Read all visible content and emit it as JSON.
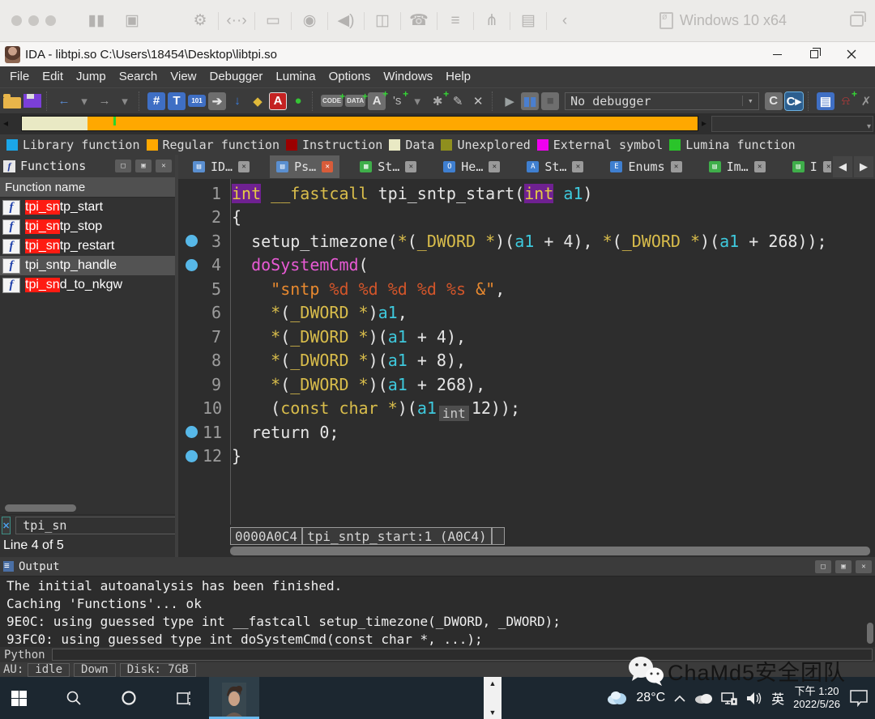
{
  "vm_toolbar": {
    "title": "Windows 10 x64",
    "icons": [
      {
        "name": "pause-icon",
        "glyph": "▮▮"
      },
      {
        "name": "snapshot-icon",
        "glyph": "▣"
      },
      {
        "name": "settings-wrench-icon",
        "glyph": "⚙",
        "gap": 40
      },
      {
        "name": "send-keys-icon",
        "glyph": "‹··›",
        "sep": true
      },
      {
        "name": "hard-disk-icon",
        "glyph": "▭",
        "sep": true
      },
      {
        "name": "webcam-icon",
        "glyph": "◉",
        "sep": true
      },
      {
        "name": "sound-icon",
        "glyph": "◀)",
        "sep": true
      },
      {
        "name": "video-camera-icon",
        "glyph": "◫",
        "sep": true
      },
      {
        "name": "phone-icon",
        "glyph": "☎",
        "sep": true
      },
      {
        "name": "server-icon",
        "glyph": "≡",
        "sep": true
      },
      {
        "name": "usb-icon",
        "glyph": "⋔",
        "sep": true
      },
      {
        "name": "clipboard-icon",
        "glyph": "▤",
        "sep": true
      },
      {
        "name": "back-chevron-icon",
        "glyph": "‹",
        "sep": true
      }
    ]
  },
  "title_bar": {
    "title": "IDA - libtpi.so C:\\Users\\18454\\Desktop\\libtpi.so"
  },
  "menu_bar": {
    "items": [
      "File",
      "Edit",
      "Jump",
      "Search",
      "View",
      "Debugger",
      "Lumina",
      "Options",
      "Windows",
      "Help"
    ]
  },
  "toolbar": {
    "debugger_combo": "No debugger",
    "icons_left": [
      {
        "name": "open-file-icon",
        "cls": "ic-folder"
      },
      {
        "name": "save-icon",
        "cls": "ic-floppy"
      },
      {
        "name": "separator",
        "sep": true
      },
      {
        "name": "back-icon",
        "glyph": "←",
        "color": "#5b8dd6",
        "bold": true
      },
      {
        "name": "back-dropdown-icon",
        "glyph": "▾",
        "color": "#8a8a8a"
      },
      {
        "name": "forward-icon",
        "glyph": "→",
        "color": "#9a9a9a",
        "bold": true
      },
      {
        "name": "forward-dropdown-icon",
        "glyph": "▾",
        "color": "#8a8a8a"
      },
      {
        "name": "separator",
        "sep": true
      },
      {
        "name": "search-address-icon",
        "chip": "chip-blue",
        "glyph": "#"
      },
      {
        "name": "search-text-icon",
        "chip": "chip-blue",
        "glyph": "T"
      },
      {
        "name": "search-binary-icon",
        "chip": "chip-blue chip-sm",
        "glyph": "101"
      },
      {
        "name": "search-next-icon",
        "chip": "chip-gray",
        "glyph": "➔"
      },
      {
        "name": "jump-icon",
        "glyph": "↓",
        "color": "#3a7fe0",
        "bold": true
      },
      {
        "name": "lumina-flashlight-icon",
        "glyph": "◆",
        "color": "#e0b93a"
      },
      {
        "name": "problems-icon",
        "chip": "chip-red",
        "glyph": "A"
      },
      {
        "name": "navband-ok-icon",
        "glyph": "●",
        "color": "#35c435"
      },
      {
        "name": "separator",
        "sep": true
      },
      {
        "name": "make-code-icon",
        "chip": "chip-gray chip-sm",
        "glyph": "CODE",
        "plus": true
      },
      {
        "name": "make-data-icon",
        "chip": "chip-gray chip-sm",
        "glyph": "DATA",
        "plus": true
      },
      {
        "name": "make-name-icon",
        "chip": "chip-gray",
        "glyph": "A",
        "plus": true
      },
      {
        "name": "make-string-icon",
        "glyph": "'s",
        "color": "#b8b8b8",
        "plus": true
      },
      {
        "name": "string-dropdown-icon",
        "glyph": "▾",
        "color": "#8a8a8a"
      },
      {
        "name": "patterns-icon",
        "glyph": "✱",
        "color": "#a8a8a8",
        "plus": true
      },
      {
        "name": "edit-icon",
        "glyph": "✎",
        "color": "#c2c2c2"
      },
      {
        "name": "delete-icon",
        "glyph": "✕",
        "color": "#c2c2c2"
      },
      {
        "name": "separator",
        "sep": true
      },
      {
        "name": "debugger-play-icon",
        "glyph": "▶",
        "color": "#9aa0a0"
      },
      {
        "name": "debugger-pause-icon",
        "chip": "chip-gray",
        "glyph": "▮▮",
        "color": "#4a7fd0"
      },
      {
        "name": "debugger-stop-icon",
        "chip": "chip-gray",
        "glyph": "■",
        "color": "#555"
      }
    ],
    "icons_right": [
      {
        "name": "attach-c-icon",
        "chip": "chip-gray",
        "glyph": "C"
      },
      {
        "name": "compile-c-icon",
        "chip": "chip-csel",
        "glyph": "C▸"
      },
      {
        "name": "separator",
        "sep": true
      },
      {
        "name": "script-notebook-icon",
        "chip": "chip-blue",
        "glyph": "▤",
        "plus": false
      },
      {
        "name": "breakpoint-icon",
        "glyph": "⍾",
        "color": "#d23a3a",
        "plus": true
      },
      {
        "name": "detach-icon",
        "glyph": "✗",
        "color": "#9a9a9a"
      }
    ]
  },
  "navband": {
    "left_arrow": "◂",
    "right_arrow": "▸",
    "segments": [
      {
        "name": "data-segment",
        "color": "#e9e9c4",
        "width_pct": 9.7
      },
      {
        "name": "regular-function-segment",
        "color": "#ffa800",
        "width_pct": 90.3
      }
    ],
    "tick": {
      "color": "#2ad42a",
      "left_pct": 13.5
    }
  },
  "legend": {
    "items": [
      {
        "label": "Library function",
        "color": "#1ba6e8"
      },
      {
        "label": "Regular function",
        "color": "#ffa800"
      },
      {
        "label": "Instruction",
        "color": "#9c0000"
      },
      {
        "label": "Data",
        "color": "#e9e9c4"
      },
      {
        "label": "Unexplored",
        "color": "#8f8f1e"
      },
      {
        "label": "External symbol",
        "color": "#f000f0"
      },
      {
        "label": "Lumina function",
        "color": "#2ac42a"
      }
    ]
  },
  "functions_panel": {
    "title": "Functions",
    "header": "Function name",
    "rows": [
      {
        "match": "tpi_sn",
        "rest": "tp_start",
        "selected": false
      },
      {
        "match": "tpi_sn",
        "rest": "tp_stop",
        "selected": false
      },
      {
        "match": "tpi_sn",
        "rest": "tp_restart",
        "selected": false
      },
      {
        "match": "",
        "rest": "tpi_sntp_handle",
        "selected": true
      },
      {
        "match": "tpi_sn",
        "rest": "d_to_nkgw",
        "selected": false
      }
    ],
    "filter_value": "tpi_sn",
    "status": "Line 4 of 5"
  },
  "tabs": {
    "items": [
      {
        "label": "ID…",
        "icon": "▤",
        "icon_color": "#5a8fd0",
        "active": false
      },
      {
        "label": "Ps…",
        "icon": "▤",
        "icon_color": "#5a8fd0",
        "active": true
      },
      {
        "label": "St…",
        "icon": "▦",
        "icon_color": "#3fae4a",
        "active": false
      },
      {
        "label": "He…",
        "icon": "O",
        "icon_color": "#3f7fd0",
        "active": false
      },
      {
        "label": "St…",
        "icon": "A",
        "icon_color": "#3f7fd0",
        "active": false
      },
      {
        "label": "Enums",
        "icon": "E",
        "icon_color": "#3f7fd0",
        "active": false
      },
      {
        "label": "Im…",
        "icon": "▤",
        "icon_color": "#3fae4a",
        "active": false
      },
      {
        "label": "I",
        "icon": "▤",
        "icon_color": "#3fae4a",
        "active": false
      }
    ],
    "scroll_left": "◀",
    "scroll_right": "▶"
  },
  "code": {
    "lines": [
      {
        "n": 1,
        "dot": false,
        "tokens": [
          {
            "c": "kwhl",
            "t": "int"
          },
          {
            "c": "pl",
            "t": " "
          },
          {
            "c": "kw",
            "t": "__fastcall"
          },
          {
            "c": "pl",
            "t": " tpi_sntp_start("
          },
          {
            "c": "kwhl",
            "t": "int"
          },
          {
            "c": "pl",
            "t": " "
          },
          {
            "c": "var",
            "t": "a1"
          },
          {
            "c": "pl",
            "t": ")"
          }
        ]
      },
      {
        "n": 2,
        "dot": false,
        "tokens": [
          {
            "c": "pl",
            "t": "{"
          }
        ]
      },
      {
        "n": 3,
        "dot": true,
        "tokens": [
          {
            "c": "pl",
            "t": "  setup_timezone("
          },
          {
            "c": "kw",
            "t": "*"
          },
          {
            "c": "pl",
            "t": "("
          },
          {
            "c": "kw",
            "t": "_DWORD *"
          },
          {
            "c": "pl",
            "t": ")("
          },
          {
            "c": "var",
            "t": "a1"
          },
          {
            "c": "pl",
            "t": " + 4), "
          },
          {
            "c": "kw",
            "t": "*"
          },
          {
            "c": "pl",
            "t": "("
          },
          {
            "c": "kw",
            "t": "_DWORD *"
          },
          {
            "c": "pl",
            "t": ")("
          },
          {
            "c": "var",
            "t": "a1"
          },
          {
            "c": "pl",
            "t": " + 268));"
          }
        ]
      },
      {
        "n": 4,
        "dot": true,
        "tokens": [
          {
            "c": "pl",
            "t": "  "
          },
          {
            "c": "pink",
            "t": "doSystemCmd"
          },
          {
            "c": "pl",
            "t": "("
          }
        ]
      },
      {
        "n": 5,
        "dot": false,
        "tokens": [
          {
            "c": "pl",
            "t": "    "
          },
          {
            "c": "str",
            "t": "\"sntp "
          },
          {
            "c": "fmt",
            "t": "%d"
          },
          {
            "c": "str",
            "t": " "
          },
          {
            "c": "fmt",
            "t": "%d"
          },
          {
            "c": "str",
            "t": " "
          },
          {
            "c": "fmt",
            "t": "%d"
          },
          {
            "c": "str",
            "t": " "
          },
          {
            "c": "fmt",
            "t": "%d"
          },
          {
            "c": "str",
            "t": " "
          },
          {
            "c": "fmt",
            "t": "%s"
          },
          {
            "c": "str",
            "t": " &\""
          },
          {
            "c": "pl",
            "t": ","
          }
        ]
      },
      {
        "n": 6,
        "dot": false,
        "tokens": [
          {
            "c": "pl",
            "t": "    "
          },
          {
            "c": "kw",
            "t": "*"
          },
          {
            "c": "pl",
            "t": "("
          },
          {
            "c": "kw",
            "t": "_DWORD *"
          },
          {
            "c": "pl",
            "t": ")"
          },
          {
            "c": "var",
            "t": "a1"
          },
          {
            "c": "pl",
            "t": ","
          }
        ]
      },
      {
        "n": 7,
        "dot": false,
        "tokens": [
          {
            "c": "pl",
            "t": "    "
          },
          {
            "c": "kw",
            "t": "*"
          },
          {
            "c": "pl",
            "t": "("
          },
          {
            "c": "kw",
            "t": "_DWORD *"
          },
          {
            "c": "pl",
            "t": ")("
          },
          {
            "c": "var",
            "t": "a1"
          },
          {
            "c": "pl",
            "t": " + 4),"
          }
        ]
      },
      {
        "n": 8,
        "dot": false,
        "tokens": [
          {
            "c": "pl",
            "t": "    "
          },
          {
            "c": "kw",
            "t": "*"
          },
          {
            "c": "pl",
            "t": "("
          },
          {
            "c": "kw",
            "t": "_DWORD *"
          },
          {
            "c": "pl",
            "t": ")("
          },
          {
            "c": "var",
            "t": "a1"
          },
          {
            "c": "pl",
            "t": " + 8),"
          }
        ]
      },
      {
        "n": 9,
        "dot": false,
        "tokens": [
          {
            "c": "pl",
            "t": "    "
          },
          {
            "c": "kw",
            "t": "*"
          },
          {
            "c": "pl",
            "t": "("
          },
          {
            "c": "kw",
            "t": "_DWORD *"
          },
          {
            "c": "pl",
            "t": ")("
          },
          {
            "c": "var",
            "t": "a1"
          },
          {
            "c": "pl",
            "t": " + 268),"
          }
        ]
      },
      {
        "n": 10,
        "dot": false,
        "tokens": [
          {
            "c": "pl",
            "t": "    ("
          },
          {
            "c": "kw",
            "t": "const char *"
          },
          {
            "c": "pl",
            "t": ")("
          },
          {
            "c": "var",
            "t": "a1"
          },
          {
            "c": "tip",
            "t": "int"
          },
          {
            "c": "pl",
            "t": "12));"
          }
        ]
      },
      {
        "n": 11,
        "dot": true,
        "tokens": [
          {
            "c": "pl",
            "t": "  return 0;"
          }
        ]
      },
      {
        "n": 12,
        "dot": true,
        "tokens": [
          {
            "c": "pl",
            "t": "}"
          }
        ]
      }
    ],
    "address_box": "0000A0C4",
    "location_box": "tpi_sntp_start:1 (A0C4)"
  },
  "output_panel": {
    "title": "Output",
    "lines": [
      "The initial autoanalysis has been finished.",
      "Caching 'Functions'... ok",
      "9E0C: using guessed type int __fastcall setup_timezone(_DWORD, _DWORD);",
      "93FC0: using guessed type int doSystemCmd(const char *, ...);"
    ],
    "python_label": "Python",
    "au_label": "AU:",
    "status_segments": [
      "idle",
      "Down",
      "Disk: 7GB"
    ]
  },
  "taskbar": {
    "temperature": "28°C",
    "ime": "英",
    "time": "下午 1:20",
    "date": "2022/5/26"
  },
  "watermark": {
    "text": "ChaMd5安全团队"
  }
}
